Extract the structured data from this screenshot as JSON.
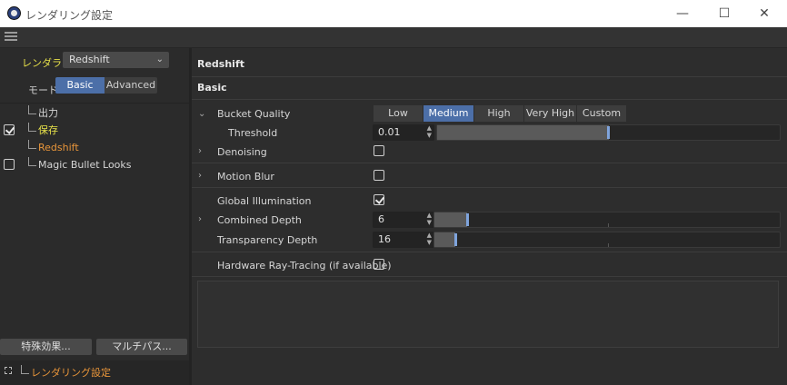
{
  "window": {
    "title": "レンダリング設定",
    "controls": {
      "minimize": "—",
      "maximize": "☐",
      "close": "✕"
    }
  },
  "sidebar": {
    "renderer_label": "レンダラー",
    "renderer_value": "Redshift",
    "mode_label": "モード",
    "mode_basic": "Basic",
    "mode_advanced": "Advanced",
    "mode_selected": "Basic",
    "tree": [
      {
        "label": "出力",
        "checkbox": false,
        "checked": false,
        "color": "#d6d6d6"
      },
      {
        "label": "保存",
        "checkbox": true,
        "checked": true,
        "color": "#e8e24a"
      },
      {
        "label": "Redshift",
        "checkbox": false,
        "checked": false,
        "color": "#e8953a"
      },
      {
        "label": "Magic Bullet Looks",
        "checkbox": true,
        "checked": false,
        "color": "#d6d6d6"
      }
    ],
    "effects_button": "特殊効果...",
    "multipass_button": "マルチパス...",
    "render_setting_item": "レンダリング設定"
  },
  "main": {
    "header": "Redshift",
    "section": "Basic",
    "bucket_quality": {
      "label": "Bucket Quality",
      "options": [
        "Low",
        "Medium",
        "High",
        "Very High",
        "Custom"
      ],
      "selected": "Medium"
    },
    "threshold": {
      "label": "Threshold",
      "value": "0.01",
      "slider_fraction": 0.5
    },
    "denoising": {
      "label": "Denoising",
      "checked": false
    },
    "motion_blur": {
      "label": "Motion Blur",
      "checked": false
    },
    "global_illumination": {
      "label": "Global Illumination",
      "checked": true
    },
    "combined_depth": {
      "label": "Combined Depth",
      "value": "6",
      "slider_fraction": 0.1
    },
    "transparency_depth": {
      "label": "Transparency Depth",
      "value": "16",
      "slider_fraction": 0.06
    },
    "hardware_rt": {
      "label": "Hardware Ray-Tracing (if available)",
      "checked": false
    }
  },
  "colors": {
    "accent_blue": "#4c6fa8",
    "yellow_label": "#e8e24a",
    "orange_label": "#e8953a",
    "slider_handle": "#7fa4dc"
  }
}
